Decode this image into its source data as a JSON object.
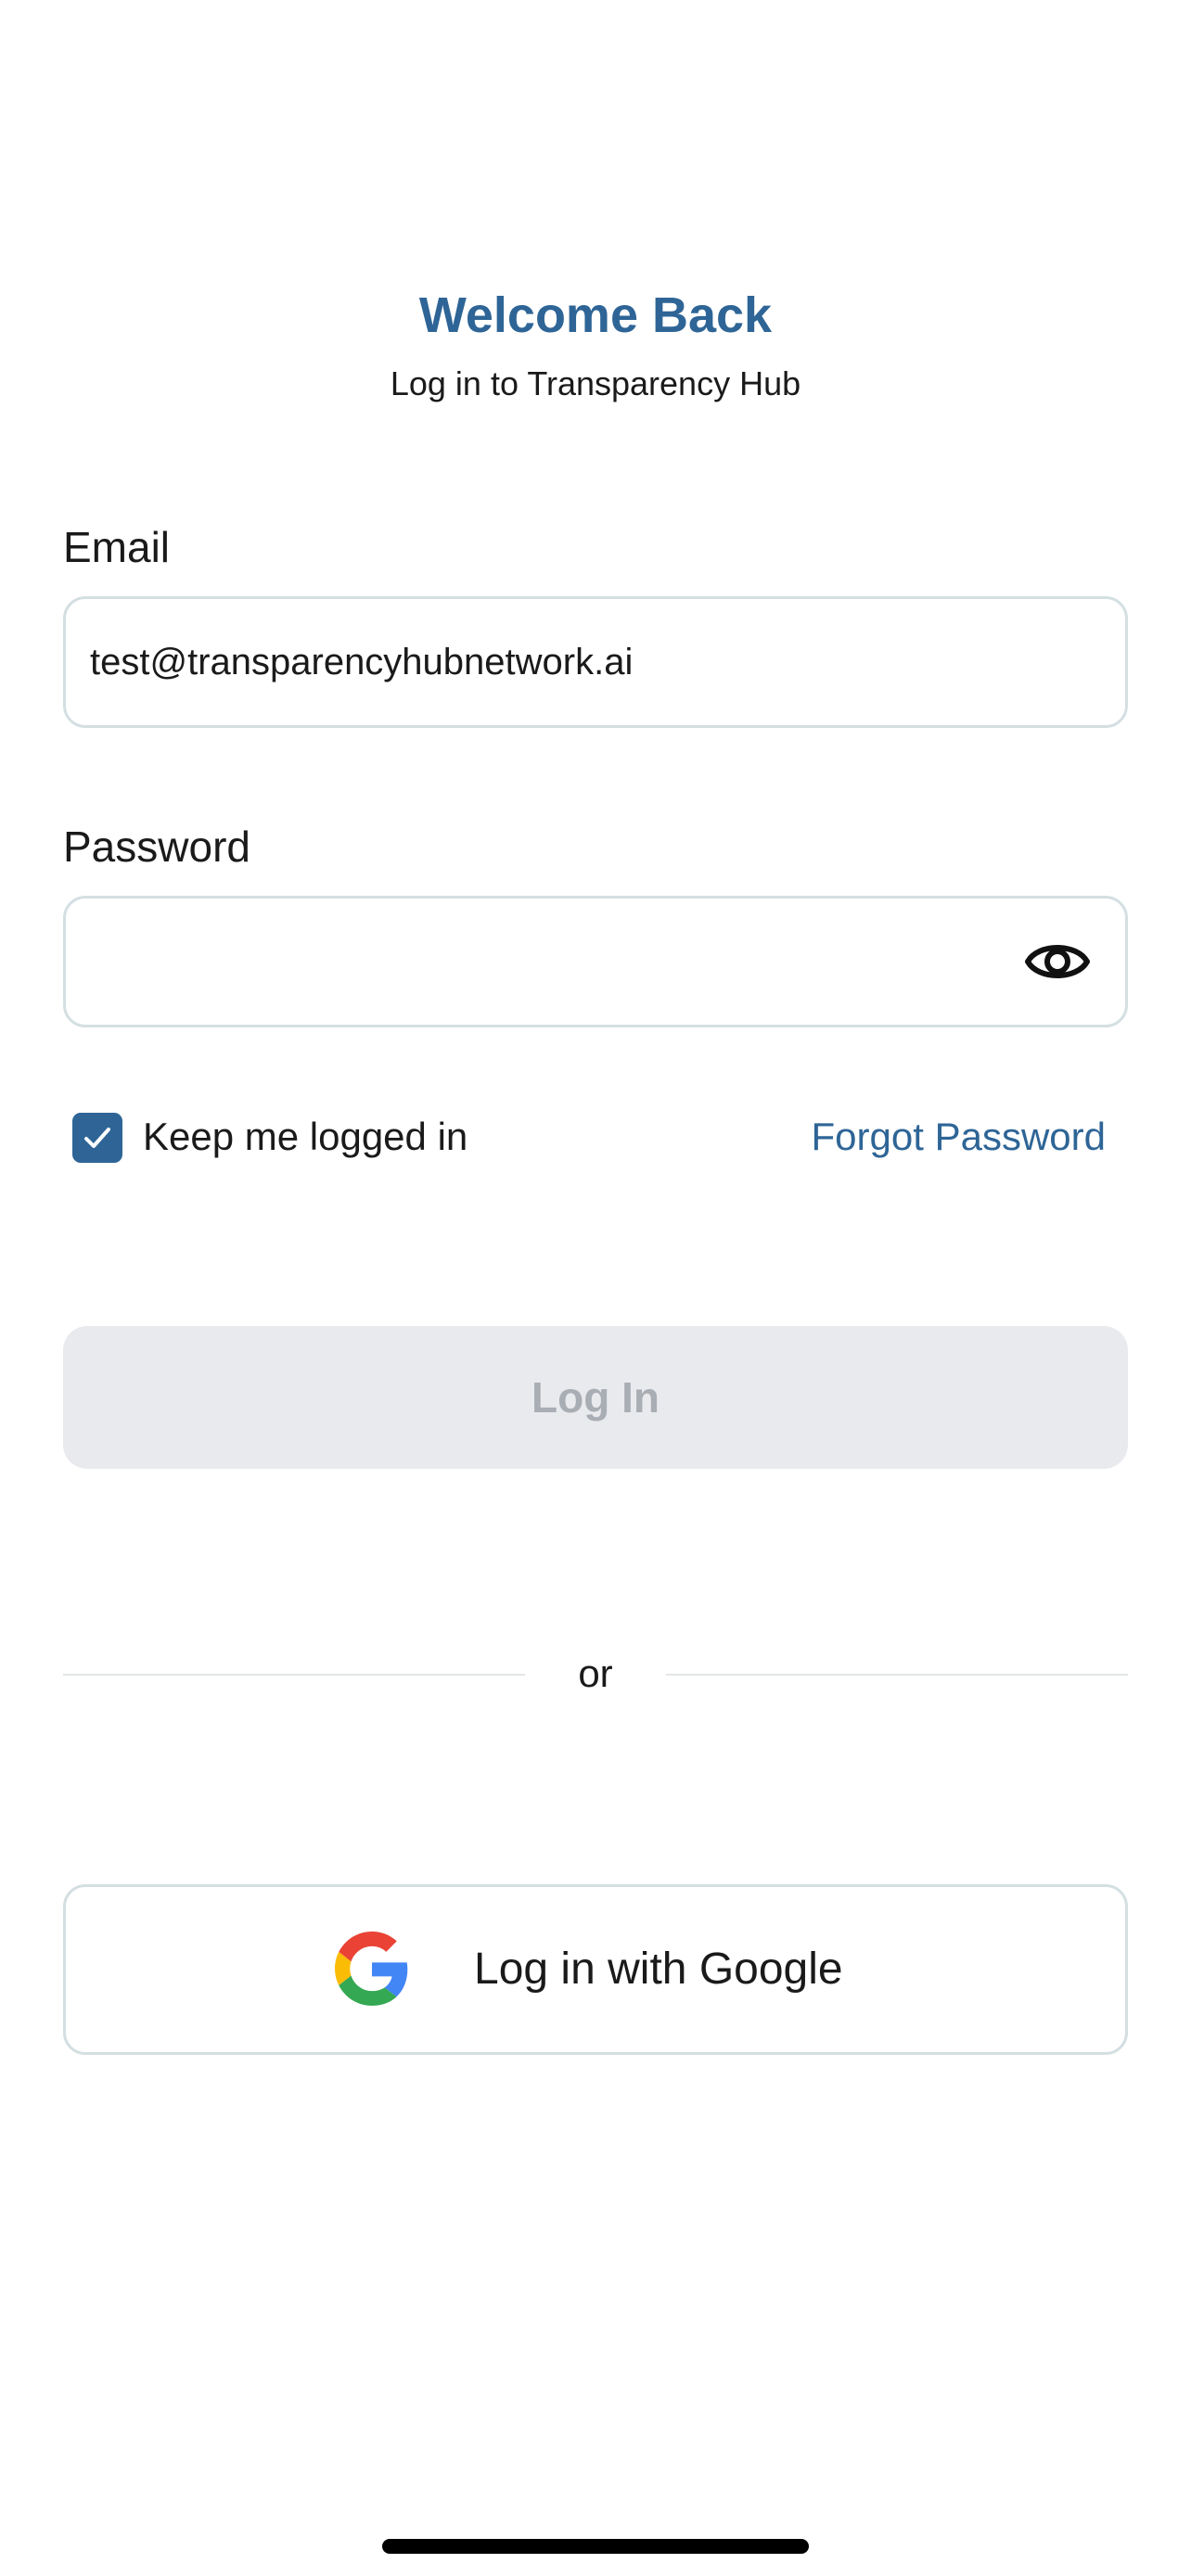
{
  "header": {
    "title": "Welcome Back",
    "subtitle": "Log in to Transparency Hub"
  },
  "email": {
    "label": "Email",
    "value": "test@transparencyhubnetwork.ai",
    "placeholder": ""
  },
  "password": {
    "label": "Password",
    "value": "",
    "placeholder": "",
    "toggle_icon": "eye-icon"
  },
  "remember": {
    "label": "Keep me logged in",
    "checked": true
  },
  "forgot_password": {
    "label": "Forgot Password"
  },
  "login_button": {
    "label": "Log In",
    "enabled": false
  },
  "divider": {
    "label": "or"
  },
  "google_button": {
    "label": "Log in with Google",
    "icon": "google-icon"
  },
  "colors": {
    "accent": "#2e6596",
    "disabled_button_bg": "#e9eaed",
    "disabled_button_text": "#a9adb4",
    "input_border": "#d4dfe2"
  }
}
